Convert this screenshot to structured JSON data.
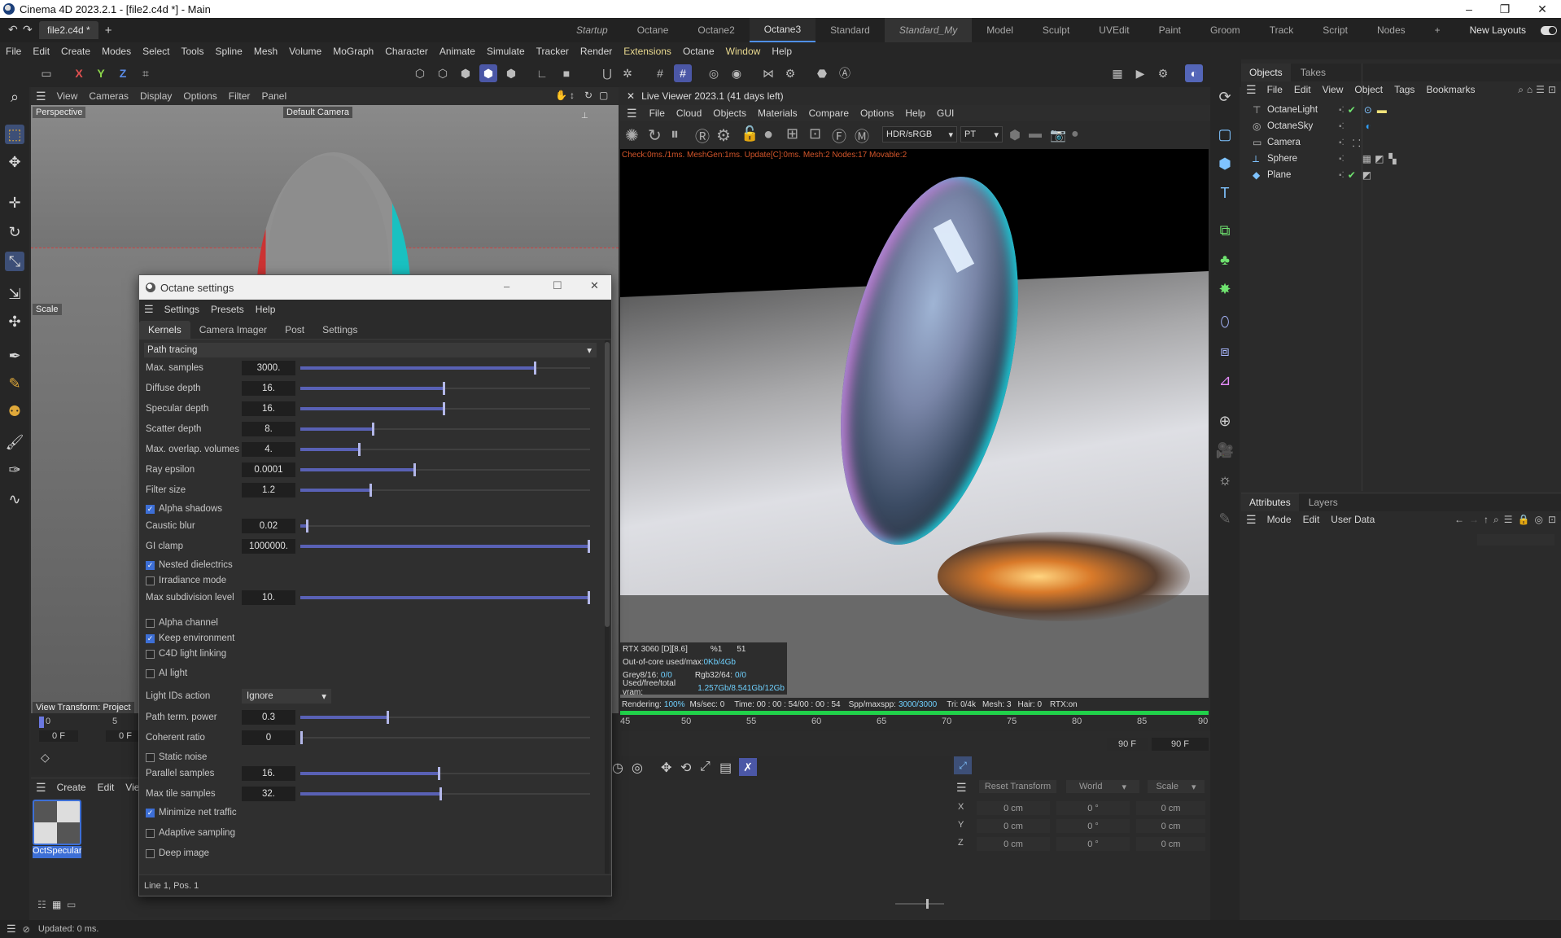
{
  "window": {
    "title": "Cinema 4D 2023.2.1 - [file2.c4d *] - Main",
    "minimize": "–",
    "maximize": "❐",
    "close": "✕"
  },
  "doc_tab": {
    "label": "file2.c4d *",
    "close": "✕",
    "add": "+"
  },
  "layouts": [
    "Startup",
    "Octane",
    "Octane2",
    "Octane3",
    "Standard",
    "Standard_My",
    "Model",
    "Sculpt",
    "UVEdit",
    "Paint",
    "Groom",
    "Track",
    "Script",
    "Nodes"
  ],
  "layouts_add": "+",
  "new_layouts": "New Layouts",
  "menu": [
    "File",
    "Edit",
    "Create",
    "Modes",
    "Select",
    "Tools",
    "Spline",
    "Mesh",
    "Volume",
    "MoGraph",
    "Character",
    "Animate",
    "Simulate",
    "Tracker",
    "Render",
    "Extensions",
    "Octane",
    "Window",
    "Help"
  ],
  "axes": {
    "x": "X",
    "y": "Y",
    "z": "Z"
  },
  "viewport": {
    "menu": [
      "View",
      "Cameras",
      "Display",
      "Options",
      "Filter",
      "Panel"
    ],
    "label": "Perspective",
    "camera": "Default Camera",
    "scale_label": "Scale",
    "view_transform": "View Transform: Project"
  },
  "octane_settings": {
    "title": "Octane settings",
    "menu": [
      "Settings",
      "Presets",
      "Help"
    ],
    "tabs": [
      "Kernels",
      "Camera Imager",
      "Post",
      "Settings"
    ],
    "kernel": "Path tracing",
    "params": [
      {
        "label": "Max. samples",
        "value": "3000.",
        "fill": 0.814
      },
      {
        "label": "Diffuse depth",
        "value": "16.",
        "fill": 0.495
      },
      {
        "label": "Specular depth",
        "value": "16.",
        "fill": 0.495
      },
      {
        "label": "Scatter depth",
        "value": "8.",
        "fill": 0.25
      },
      {
        "label": "Max. overlap. volumes",
        "value": "4.",
        "fill": 0.2
      },
      {
        "label": "Ray epsilon",
        "value": "0.0001",
        "fill": 0.395
      },
      {
        "label": "Filter size",
        "value": "1.2",
        "fill": 0.24
      }
    ],
    "alpha_shadows": "Alpha shadows",
    "caustic": {
      "label": "Caustic blur",
      "value": "0.02",
      "fill": 0.02
    },
    "gi_clamp": {
      "label": "GI clamp",
      "value": "1000000.",
      "fill": 1.0
    },
    "nested_dielectrics": "Nested dielectrics",
    "irradiance_mode": "Irradiance mode",
    "max_subdiv": {
      "label": "Max subdivision level",
      "value": "10.",
      "fill": 1.0
    },
    "alpha_channel": "Alpha channel",
    "keep_environment": "Keep environment",
    "c4d_light_linking": "C4D light linking",
    "ai_light": "AI light",
    "light_ids": {
      "label": "Light IDs action",
      "value": "Ignore"
    },
    "path_term": {
      "label": "Path term. power",
      "value": "0.3",
      "fill": 0.3
    },
    "coherent": {
      "label": "Coherent ratio",
      "value": "0",
      "fill": 0.0
    },
    "static_noise": "Static noise",
    "parallel": {
      "label": "Parallel samples",
      "value": "16.",
      "fill": 0.48
    },
    "max_tile": {
      "label": "Max tile samples",
      "value": "32.",
      "fill": 0.485
    },
    "minimize_net": "Minimize net traffic",
    "adaptive": "Adaptive sampling",
    "deep_image": "Deep image",
    "status": "Line 1, Pos. 1"
  },
  "live_viewer": {
    "title": "Live Viewer 2023.1 (41 days left)",
    "menu": [
      "File",
      "Cloud",
      "Objects",
      "Materials",
      "Compare",
      "Options",
      "Help",
      "GUI"
    ],
    "colorspace": "HDR/sRGB",
    "kernel": "PT",
    "info": "Check:0ms./1ms. MeshGen:1ms. Update[C]:0ms. Mesh:2 Nodes:17 Movable:2",
    "gpu": "RTX 3060 [D][8.6]",
    "gpu_pct": "%1",
    "gpu_temp": "51",
    "ooc_label": "Out-of-core used/max:",
    "ooc_value": "0Kb/4Gb",
    "grey_label": "Grey8/16:",
    "grey_value": "0/0",
    "rgb_label": "Rgb32/64:",
    "rgb_value": "0/0",
    "vram_label": "Used/free/total vram:",
    "vram_value": "1.257Gb/8.541Gb/12Gb",
    "rendering_label": "Rendering:",
    "rendering_pct": "100%",
    "ms_sec": "Ms/sec: 0",
    "time": "Time: 00 : 00 : 54/00 : 00 : 54",
    "spp_label": "Spp/maxspp:",
    "spp_value": "3000/3000",
    "tri": "Tri: 0/4k",
    "mesh": "Mesh: 3",
    "hair": "Hair: 0",
    "rtx": "RTX:on",
    "progress": 1.0
  },
  "timeline": {
    "left_ticks": [
      "0",
      "5"
    ],
    "right_ticks": [
      "45",
      "50",
      "55",
      "60",
      "65",
      "70",
      "75",
      "80",
      "85",
      "90"
    ],
    "frame_a": "0 F",
    "frame_b": "0 F",
    "end_a": "90 F",
    "end_b": "90 F"
  },
  "material_manager": {
    "menu": [
      "Create",
      "Edit",
      "View"
    ],
    "material": "OctSpecular"
  },
  "coordinates": {
    "reset": "Reset Transform",
    "world": "World",
    "scale": "Scale",
    "rows": [
      {
        "axis": "X",
        "a": "0 cm",
        "b": "0 °",
        "c": "0 cm"
      },
      {
        "axis": "Y",
        "a": "0 cm",
        "b": "0 °",
        "c": "0 cm"
      },
      {
        "axis": "Z",
        "a": "0 cm",
        "b": "0 °",
        "c": "0 cm"
      }
    ]
  },
  "objects": {
    "tabs": [
      "Objects",
      "Takes"
    ],
    "menu": [
      "File",
      "Edit",
      "View",
      "Object",
      "Tags",
      "Bookmarks"
    ],
    "items": [
      "OctaneLight",
      "OctaneSky",
      "Camera",
      "Sphere",
      "Plane"
    ]
  },
  "attributes": {
    "tabs": [
      "Attributes",
      "Layers"
    ],
    "menu": [
      "Mode",
      "Edit",
      "User Data"
    ]
  },
  "status": "Updated: 0 ms."
}
